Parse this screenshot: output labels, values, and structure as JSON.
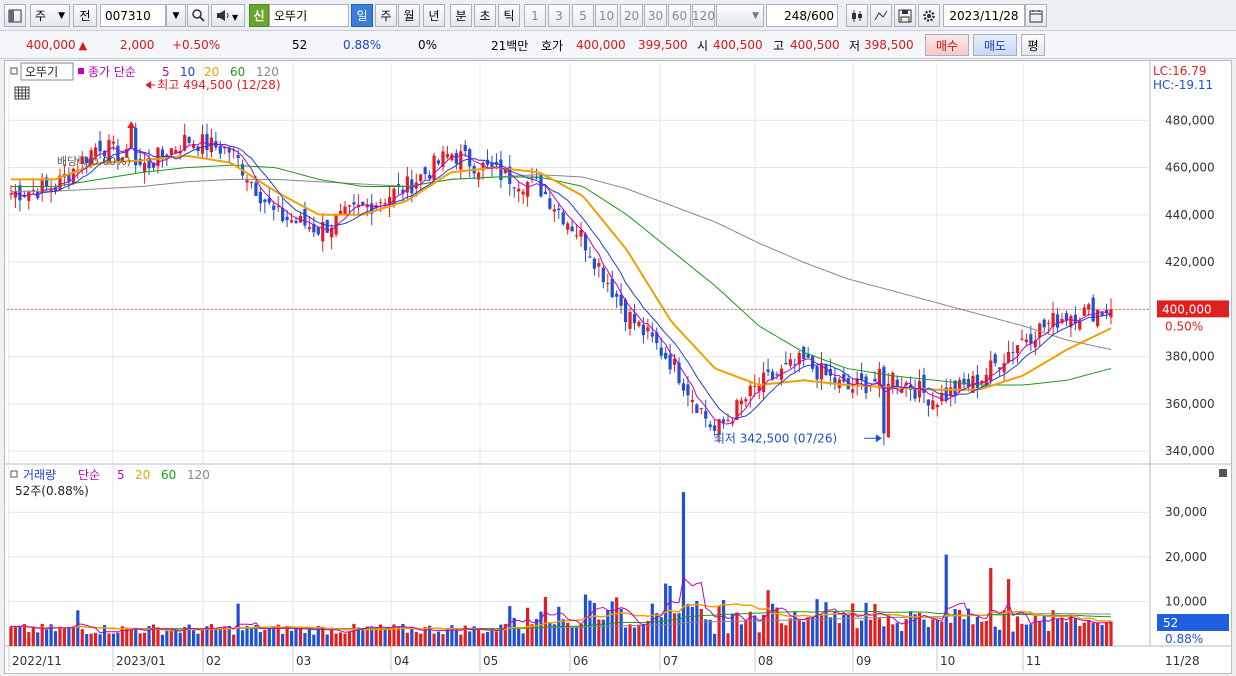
{
  "toolbar": {
    "market": "주",
    "period_prefix": "전",
    "stock_code": "007310",
    "credit_badge": "신",
    "stock_name": "오뚜기",
    "intervals": [
      "일",
      "주",
      "월",
      "년",
      "분",
      "초",
      "틱"
    ],
    "active_interval": "일",
    "minute_options": [
      "1",
      "3",
      "5",
      "10",
      "20",
      "30",
      "60",
      "120"
    ],
    "bar_count": "248",
    "bar_max": "/600",
    "date": "2023/11/28"
  },
  "quote": {
    "price": "400,000",
    "change": "2,000",
    "change_pct": "+0.50%",
    "volume": "52",
    "volume_ratio": "0.88%",
    "pct0": "0%",
    "amount": "21백만",
    "hoga_label": "호가",
    "ask": "400,000",
    "bid": "399,500",
    "open_label": "시",
    "open": "400,500",
    "high_label": "고",
    "high": "400,500",
    "low_label": "저",
    "low": "398,500",
    "buy_label": "매수",
    "sell_label": "매도",
    "avg_label": "평"
  },
  "price_panel": {
    "name_tag": "오뚜기",
    "legend_prefix": "종가 단순",
    "ma_labels": [
      "5",
      "10",
      "20",
      "60",
      "120"
    ],
    "high_marker": "최고 494,500 (12/28)",
    "low_marker": "최저 342,500 (07/26)",
    "dividend_note": "배당락(0.00%)",
    "lc": "LC:16.79",
    "hc": "HC:-19.11",
    "current_price": "400,000",
    "current_pct": "0.50%",
    "y_ticks": [
      "480,000",
      "460,000",
      "440,000",
      "420,000",
      "400,000",
      "380,000",
      "360,000",
      "340,000"
    ]
  },
  "volume_panel": {
    "title": "거래량",
    "legend_prefix": "단순",
    "ma_labels": [
      "5",
      "20",
      "60",
      "120"
    ],
    "current_text": "52주(0.88%)",
    "y_ticks": [
      "30,000",
      "20,000",
      "10,000"
    ],
    "current_value": "52",
    "current_pct": "0.88%"
  },
  "x_axis": {
    "labels": [
      "2022/11",
      "2023/01",
      "02",
      "03",
      "04",
      "05",
      "06",
      "07",
      "08",
      "09",
      "10",
      "11"
    ],
    "last_label": "11/28"
  },
  "colors": {
    "up": "#e41e1e",
    "down": "#1f4fd6",
    "ma5": "#c000c0",
    "ma10": "#1d3ed8",
    "ma20": "#f0a000",
    "ma60": "#1a9a1a",
    "ma120": "#888888"
  },
  "chart_data": {
    "type": "candlestick",
    "ylim": [
      335000,
      500000
    ],
    "volume_ylim": [
      0,
      37000
    ],
    "high_point": {
      "date": "12/28",
      "value": 494500
    },
    "low_point": {
      "date": "07/26",
      "value": 342500
    },
    "close_series": [
      {
        "date": "2022/11",
        "value": 449000
      },
      {
        "date": "2022/12 early",
        "value": 452000
      },
      {
        "date": "12/28",
        "value": 470000
      },
      {
        "date": "2023/01",
        "value": 460000
      },
      {
        "date": "02",
        "value": 472000
      },
      {
        "date": "02 late",
        "value": 467000
      },
      {
        "date": "03",
        "value": 440000
      },
      {
        "date": "03 mid",
        "value": 434000
      },
      {
        "date": "04",
        "value": 443000
      },
      {
        "date": "04 late",
        "value": 452000
      },
      {
        "date": "05",
        "value": 466000
      },
      {
        "date": "05 late",
        "value": 458000
      },
      {
        "date": "06",
        "value": 452000
      },
      {
        "date": "06 mid",
        "value": 430000
      },
      {
        "date": "07",
        "value": 398000
      },
      {
        "date": "07 mid",
        "value": 378000
      },
      {
        "date": "07/26",
        "value": 348000
      },
      {
        "date": "08",
        "value": 368000
      },
      {
        "date": "08 mid",
        "value": 378000
      },
      {
        "date": "09",
        "value": 366000
      },
      {
        "date": "09 late",
        "value": 372000
      },
      {
        "date": "10",
        "value": 362000
      },
      {
        "date": "10 late",
        "value": 370000
      },
      {
        "date": "11",
        "value": 388000
      },
      {
        "date": "11 mid",
        "value": 398000
      },
      {
        "date": "11/28",
        "value": 400000
      }
    ],
    "ma20_series": [
      455000,
      455000,
      462000,
      463000,
      465000,
      462000,
      450000,
      440000,
      440000,
      446000,
      458000,
      460000,
      458000,
      448000,
      425000,
      395000,
      375000,
      368000,
      370000,
      368000,
      367000,
      366000,
      366000,
      372000,
      383000,
      392000
    ],
    "ma60_series": [
      452000,
      452000,
      455000,
      458000,
      460000,
      461000,
      460000,
      455000,
      452000,
      452000,
      455000,
      456000,
      456000,
      452000,
      440000,
      425000,
      410000,
      393000,
      382000,
      375000,
      372000,
      370000,
      368000,
      368000,
      370000,
      375000
    ],
    "ma120_series": [
      450000,
      450000,
      451000,
      452000,
      454000,
      455000,
      455000,
      454000,
      453000,
      452000,
      455000,
      456000,
      457000,
      456000,
      451000,
      444000,
      437000,
      428000,
      420000,
      413000,
      408000,
      403000,
      398000,
      393000,
      387000,
      383000
    ],
    "volume_peaks": [
      {
        "date": "08",
        "value": 34500
      },
      {
        "date": "10 late",
        "value": 20500
      },
      {
        "date": "11 mid",
        "value": 17500
      }
    ]
  }
}
